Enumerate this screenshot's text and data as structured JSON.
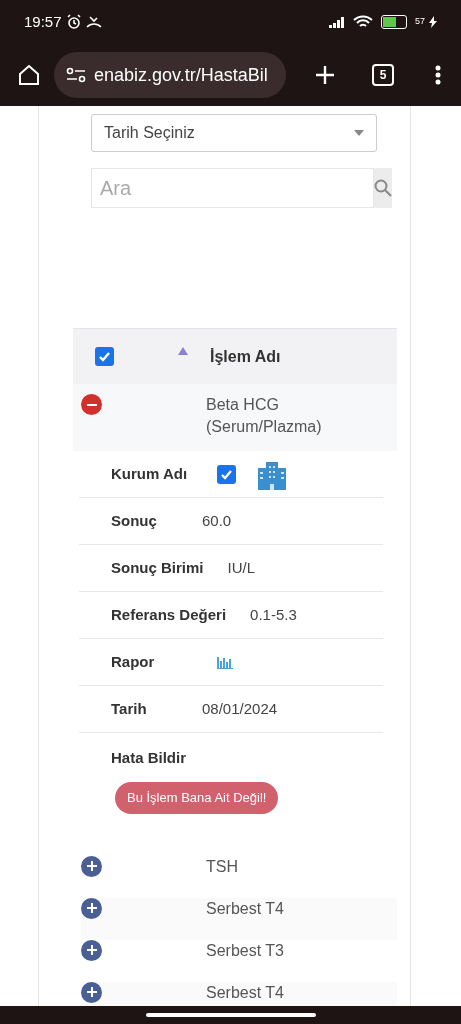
{
  "status_bar": {
    "time": "19:57",
    "battery": "57"
  },
  "browser": {
    "url": "enabiz.gov.tr/HastaBil",
    "tab_count": "5"
  },
  "filters": {
    "date_select": "Tarih Seçiniz",
    "search_placeholder": "Ara"
  },
  "table": {
    "header": {
      "checked": true,
      "sort_ascending": true,
      "column": "İşlem Adı"
    },
    "rows": [
      {
        "name": "Beta HCG (Serum/Plazma)",
        "expanded": true,
        "details": [
          {
            "kind": "checkbox_icon",
            "label": "Kurum Adı",
            "checked": true
          },
          {
            "kind": "text",
            "label": "Sonuç",
            "value": "60.0"
          },
          {
            "kind": "text",
            "label": "Sonuç Birimi",
            "value": "IU/L"
          },
          {
            "kind": "text",
            "label": "Referans Değeri",
            "value": "0.1-5.3"
          },
          {
            "kind": "chart_icon",
            "label": "Rapor"
          },
          {
            "kind": "text",
            "label": "Tarih",
            "value": "08/01/2024"
          }
        ],
        "error_label": "Hata Bildir",
        "error_button": "Bu İşlem Bana Ait Değil!"
      },
      {
        "name": "TSH",
        "expanded": false
      },
      {
        "name": "Serbest T4",
        "expanded": false
      },
      {
        "name": "Serbest T3",
        "expanded": false
      },
      {
        "name": "Serbest T4",
        "expanded": false
      }
    ]
  }
}
